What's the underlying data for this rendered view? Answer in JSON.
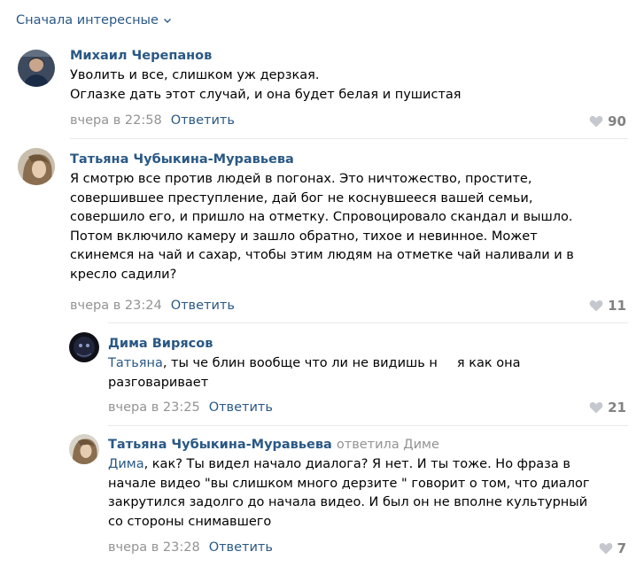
{
  "sort": {
    "label": "Сначала интересные"
  },
  "comments": [
    {
      "author": "Михаил Черепанов",
      "lines": [
        "Уволить и все, слишком уж дерзкая.",
        "Оглазке дать этот случай, и она будет белая и пушистая"
      ],
      "time": "вчера в 22:58",
      "reply_label": "Ответить",
      "likes": "90"
    },
    {
      "author": "Татьяна Чубыкина-Муравьева",
      "lines": [
        "Я смотрю все против людей в погонах. Это ничтожество, простите,",
        "совершившее преступление, дай бог не коснувшееся вашей семьи,",
        "совершило его, и пришло на отметку. Спровоцировало скандал и вышло.",
        "Потом включило камеру и зашло обратно, тихое и невинное. Может",
        "скинемся на чай и сахар, чтобы этим людям на отметке чай наливали и в",
        "кресло садили?"
      ],
      "time": "вчера в 23:24",
      "reply_label": "Ответить",
      "likes": "11"
    },
    {
      "author": "Дима Вирясов",
      "mention": "Татьяна",
      "line1_a": ", ты че блин вообще что ли не видишь н",
      "line1_b": "я как она",
      "line2": "разговаривает",
      "time": "вчера в 23:25",
      "reply_label": "Ответить",
      "likes": "21"
    },
    {
      "author": "Татьяна Чубыкина-Муравьева",
      "reply_to": "ответила Диме",
      "mention": "Дима",
      "line1_rest": ", как? Ты видел начало диалога? Я нет. И ты тоже. Но фраза в",
      "lines": [
        "начале видео \"вы слишком много дерзите \" говорит о том, что диалог",
        "закрутился задолго до начала видео. И был он не вполне культурный",
        "со стороны снимавшего"
      ],
      "time": "вчера в 23:28",
      "reply_label": "Ответить",
      "likes": "7"
    }
  ]
}
